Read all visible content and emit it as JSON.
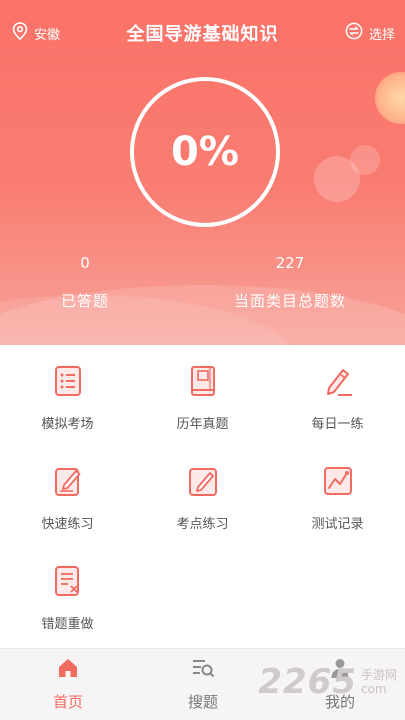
{
  "header": {
    "location": "安徽",
    "title": "全国导游基础知识",
    "choose_label": "选择"
  },
  "progress": {
    "percent_text": "0%"
  },
  "stats": {
    "answered_value": "0",
    "answered_label": "已答题",
    "total_value": "227",
    "total_label": "当面类目总题数"
  },
  "grid": {
    "items": [
      {
        "label": "模拟考场",
        "icon": "list-doc-icon"
      },
      {
        "label": "历年真题",
        "icon": "book-icon"
      },
      {
        "label": "每日一练",
        "icon": "pencil-icon"
      },
      {
        "label": "快速练习",
        "icon": "edit-note-icon"
      },
      {
        "label": "考点练习",
        "icon": "pen-square-icon"
      },
      {
        "label": "测试记录",
        "icon": "chart-line-icon"
      },
      {
        "label": "错题重做",
        "icon": "wrong-doc-icon"
      }
    ]
  },
  "tabs": [
    {
      "label": "首页",
      "icon": "home-icon",
      "active": true
    },
    {
      "label": "搜题",
      "icon": "search-list-icon",
      "active": false
    },
    {
      "label": "我的",
      "icon": "user-icon",
      "active": false
    }
  ],
  "watermark": {
    "number": "2265",
    "line1": "手游网",
    "line2": "com"
  },
  "colors": {
    "accent": "#f06b60",
    "hero_top": "#fa7268",
    "hero_bottom": "#f8a39a",
    "tile_label": "#555555"
  }
}
